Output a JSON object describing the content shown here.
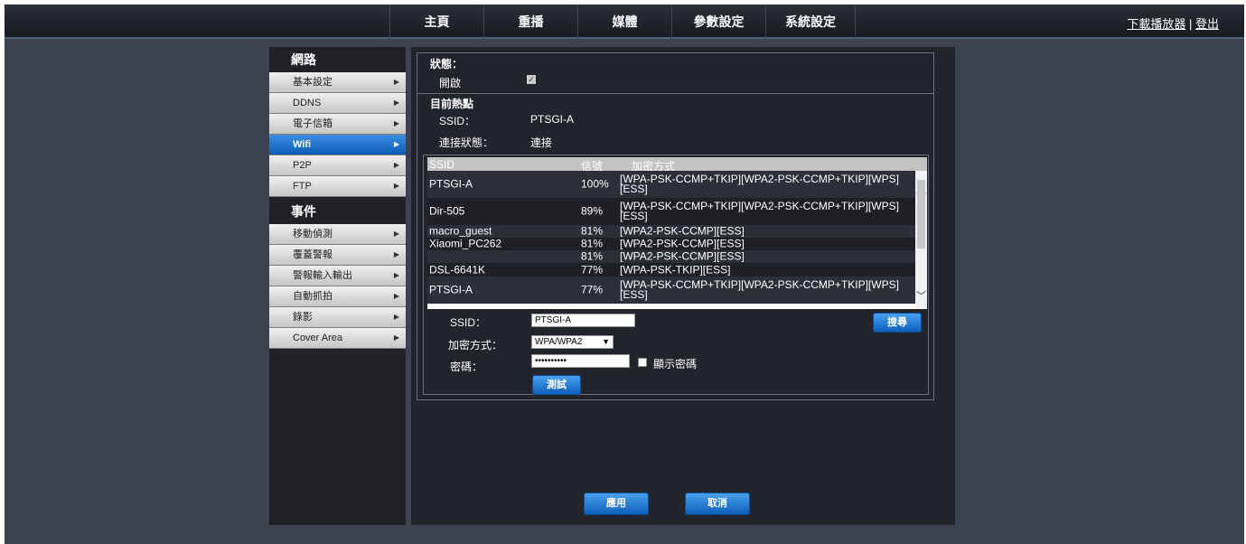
{
  "header": {
    "nav": [
      "主頁",
      "重播",
      "媒體",
      "參數設定",
      "系統設定"
    ],
    "download": "下載播放器",
    "separator": " | ",
    "logout": "登出"
  },
  "sidebar": {
    "sections": [
      {
        "title": "網路",
        "items": [
          {
            "label": "基本設定",
            "active": false
          },
          {
            "label": "DDNS",
            "active": false
          },
          {
            "label": "電子信箱",
            "active": false
          },
          {
            "label": "Wifi",
            "active": true
          },
          {
            "label": "P2P",
            "active": false
          },
          {
            "label": "FTP",
            "active": false
          }
        ]
      },
      {
        "title": "事件",
        "items": [
          {
            "label": "移動偵測",
            "active": false
          },
          {
            "label": "覆蓋警報",
            "active": false
          },
          {
            "label": "警報輸入輸出",
            "active": false
          },
          {
            "label": "自動抓拍",
            "active": false
          },
          {
            "label": "錄影",
            "active": false
          },
          {
            "label": "Cover Area",
            "active": false
          }
        ]
      }
    ]
  },
  "status": {
    "title": "狀態：",
    "enable_label": "開啟",
    "enabled": true
  },
  "current": {
    "title": "目前熱點",
    "ssid_label": "SSID：",
    "ssid": "PTSGI-A",
    "conn_label": "連接狀態：",
    "conn": "連接"
  },
  "table": {
    "headers": [
      "SSID",
      "信號",
      "加密方式"
    ],
    "rows": [
      {
        "ssid": "PTSGI-A",
        "signal": "100%",
        "enc": "[WPA-PSK-CCMP+TKIP][WPA2-PSK-CCMP+TKIP][WPS][ESS]"
      },
      {
        "ssid": "Dir-505",
        "signal": "89%",
        "enc": "[WPA-PSK-CCMP+TKIP][WPA2-PSK-CCMP+TKIP][WPS][ESS]"
      },
      {
        "ssid": "macro_guest",
        "signal": "81%",
        "enc": "[WPA2-PSK-CCMP][ESS]"
      },
      {
        "ssid": "Xiaomi_PC262",
        "signal": "81%",
        "enc": "[WPA2-PSK-CCMP][ESS]"
      },
      {
        "ssid": "",
        "signal": "81%",
        "enc": "[WPA2-PSK-CCMP][ESS]"
      },
      {
        "ssid": "DSL-6641K",
        "signal": "77%",
        "enc": "[WPA-PSK-TKIP][ESS]"
      },
      {
        "ssid": "PTSGI-A",
        "signal": "77%",
        "enc": "[WPA-PSK-CCMP+TKIP][WPA2-PSK-CCMP+TKIP][WPS][ESS]"
      }
    ]
  },
  "form": {
    "ssid_label": "SSID：",
    "ssid_value": "PTSGI-A",
    "enc_label": "加密方式：",
    "enc_value": "WPA/WPA2",
    "pwd_label": "密碼：",
    "pwd_value": "••••••••••",
    "show_pwd_label": "顯示密碼",
    "search": "搜尋",
    "test": "測試"
  },
  "footer": {
    "apply": "應用",
    "cancel": "取消"
  },
  "colors": {
    "row_even": "#2c2f37",
    "row_odd": "#1e2026",
    "accent": "#0b5cb8"
  }
}
